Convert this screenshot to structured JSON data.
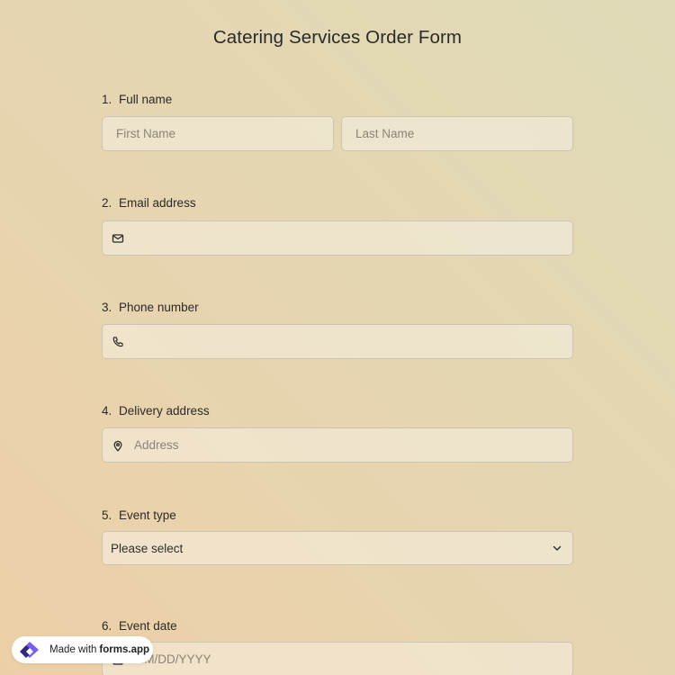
{
  "form": {
    "title": "Catering Services Order Form"
  },
  "questions": [
    {
      "number": "1.",
      "label": "Full name",
      "first_placeholder": "First Name",
      "last_placeholder": "Last Name"
    },
    {
      "number": "2.",
      "label": "Email address",
      "icon": "mail-icon"
    },
    {
      "number": "3.",
      "label": "Phone number",
      "icon": "phone-icon"
    },
    {
      "number": "4.",
      "label": "Delivery address",
      "icon": "location-pin-icon",
      "placeholder": "Address"
    },
    {
      "number": "5.",
      "label": "Event type",
      "value": "Please select",
      "icon": "chevron-down-icon"
    },
    {
      "number": "6.",
      "label": "Event date",
      "icon": "calendar-icon",
      "placeholder": "MM/DD/YYYY"
    }
  ],
  "badge": {
    "prefix": "Made with",
    "brand": "forms.app",
    "icon": "forms-app-logo"
  }
}
